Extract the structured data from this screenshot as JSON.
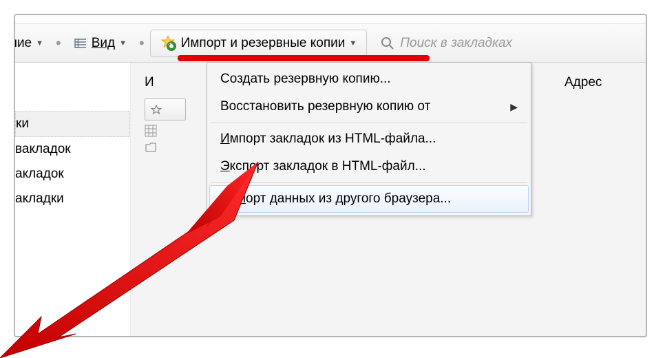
{
  "toolbar": {
    "manage_partial": "равление",
    "view": "Вид",
    "import_backup": "Импорт и резервные копии",
    "search_placeholder": "Поиск в закладках"
  },
  "detail": {
    "name_label_partial": "И",
    "address_label": "Адрес"
  },
  "sidebar": {
    "items": [
      "ки",
      "вакладок",
      "акладок",
      "акладки"
    ]
  },
  "menu": {
    "backup": "Создать резервную копию...",
    "restore": "Восстановить резервную копию от",
    "import_html_pre": "Импорт закладок из HTML-файла...",
    "export_html_pre": "Экспорт закладок в HTML-файл...",
    "import_browser": "Импорт данных из другого браузера..."
  }
}
